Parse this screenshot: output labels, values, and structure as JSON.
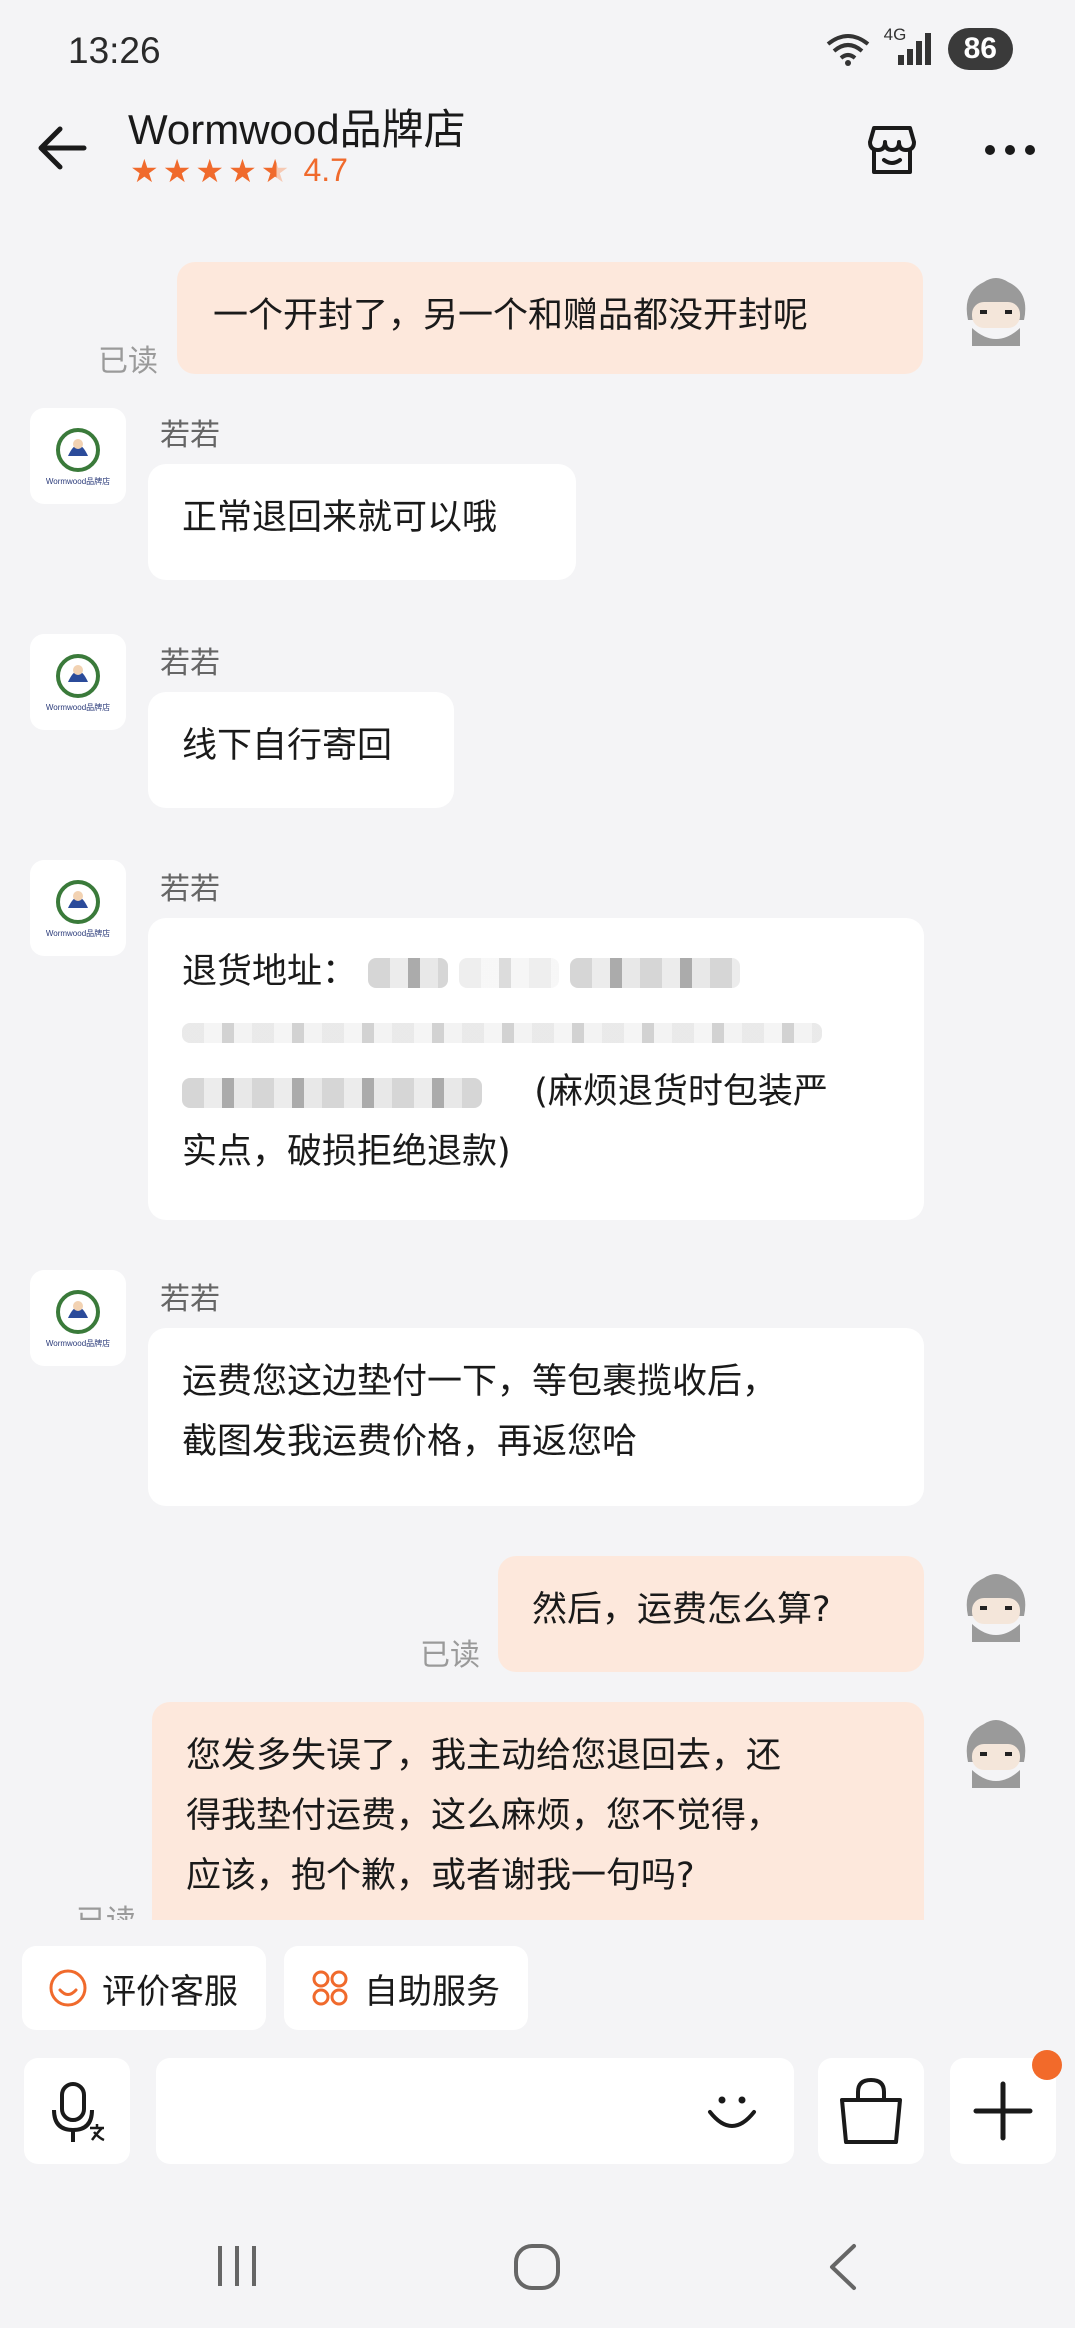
{
  "status_bar": {
    "time": "13:26",
    "network": "4G",
    "battery": "86"
  },
  "header": {
    "shop_name": "Wormwood品牌店",
    "rating": "4.7"
  },
  "shop_logo_text": "Wormwood品牌店",
  "messages": [
    {
      "from": "me",
      "text": "一个开封了，另一个和赠品都没开封呢",
      "status": "已读"
    },
    {
      "from": "shop",
      "sender": "若若",
      "text": "正常退回来就可以哦"
    },
    {
      "from": "shop",
      "sender": "若若",
      "text": "线下自行寄回"
    },
    {
      "from": "shop",
      "sender": "若若",
      "label": "退货地址：",
      "tail_a": "(麻烦退货时包装严",
      "tail_b": "实点，破损拒绝退款)"
    },
    {
      "from": "shop",
      "sender": "若若",
      "line1": "运费您这边垫付一下，等包裹揽收后，",
      "line2": "截图发我运费价格，再返您哈"
    },
    {
      "from": "me",
      "text": "然后，运费怎么算?",
      "status": "已读"
    },
    {
      "from": "me",
      "line1": "您发多失误了，我主动给您退回去，还",
      "line2": "得我垫付运费，这么麻烦，您不觉得，",
      "line3": "应该，抱个歉，或者谢我一句吗?",
      "status": "已读"
    }
  ],
  "quick_actions": [
    {
      "label": "评价客服",
      "icon": "smile-icon"
    },
    {
      "label": "自助服务",
      "icon": "grid-icon"
    }
  ],
  "colors": {
    "accent": "#f06a2c",
    "my_bubble": "#fde8dc",
    "background": "#f4f4f6"
  }
}
